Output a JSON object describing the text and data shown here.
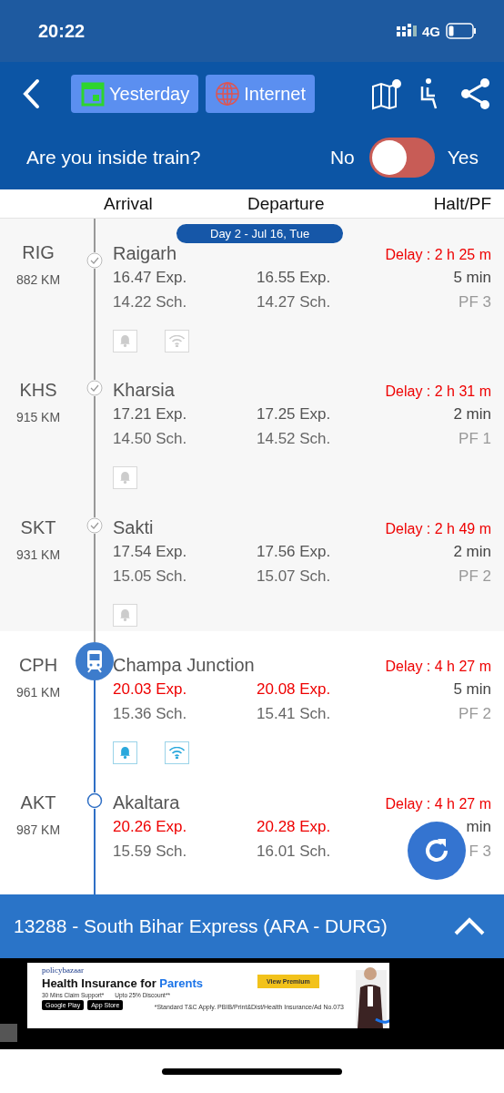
{
  "status_bar": {
    "time": "20:22",
    "network": "4G"
  },
  "toolbar": {
    "buttons": [
      {
        "kind": "calendar",
        "label": "Yesterday"
      },
      {
        "kind": "globe",
        "label": "Internet"
      }
    ]
  },
  "inside_train": {
    "question": "Are you inside train?",
    "no_label": "No",
    "yes_label": "Yes",
    "on": false
  },
  "columns": [
    "Arrival",
    "Departure",
    "Halt/PF"
  ],
  "stations": [
    {
      "code": "RIG",
      "km": "882 KM",
      "name": "Raigarh",
      "day_label": "Day 2 - Jul 16, Tue",
      "delay": "Delay : 2 h  25 m",
      "arr_exp": "16.47 Exp.",
      "dep_exp": "16.55 Exp.",
      "halt": "5 min",
      "arr_sch": "14.22 Sch.",
      "dep_sch": "14.27 Sch.",
      "pf": "PF 3",
      "passed": true,
      "current": false,
      "late": false,
      "amenities": [
        {
          "kind": "alarm",
          "active": false
        },
        {
          "kind": "wifi",
          "active": false
        }
      ]
    },
    {
      "code": "KHS",
      "km": "915 KM",
      "name": "Kharsia",
      "delay": "Delay : 2 h  31 m",
      "arr_exp": "17.21 Exp.",
      "dep_exp": "17.25 Exp.",
      "halt": "2 min",
      "arr_sch": "14.50 Sch.",
      "dep_sch": "14.52 Sch.",
      "pf": "PF 1",
      "passed": true,
      "current": false,
      "late": false,
      "amenities": [
        {
          "kind": "alarm",
          "active": false
        }
      ]
    },
    {
      "code": "SKT",
      "km": "931 KM",
      "name": "Sakti",
      "delay": "Delay : 2 h  49 m",
      "arr_exp": "17.54 Exp.",
      "dep_exp": "17.56 Exp.",
      "halt": "2 min",
      "arr_sch": "15.05 Sch.",
      "dep_sch": "15.07 Sch.",
      "pf": "PF 2",
      "passed": true,
      "current": false,
      "late": false,
      "amenities": [
        {
          "kind": "alarm",
          "active": false
        }
      ]
    },
    {
      "code": "CPH",
      "km": "961 KM",
      "name": "Champa Junction",
      "delay": "Delay : 4 h  27 m",
      "arr_exp": "20.03 Exp.",
      "dep_exp": "20.08 Exp.",
      "halt": "5 min",
      "arr_sch": "15.36 Sch.",
      "dep_sch": "15.41 Sch.",
      "pf": "PF 2",
      "passed": false,
      "current": true,
      "late": true,
      "amenities": [
        {
          "kind": "alarm",
          "active": true
        },
        {
          "kind": "wifi",
          "active": true
        }
      ]
    },
    {
      "code": "AKT",
      "km": "987 KM",
      "name": "Akaltara",
      "delay": "Delay : 4 h  27 m",
      "arr_exp": "20.26 Exp.",
      "dep_exp": "20.28 Exp.",
      "halt": "min",
      "arr_sch": "15.59 Sch.",
      "dep_sch": "16.01 Sch.",
      "pf": "F 3",
      "passed": false,
      "current": false,
      "late": true
    }
  ],
  "train_bar": {
    "title": "13288 - South Bihar Express (ARA - DURG)"
  },
  "ad": {
    "logo": "policybazaar",
    "headline": "Health Insurance for",
    "headline_highlight": "Parents",
    "points": [
      "30 Mins Claim Support*",
      "Upto 25% Discount**"
    ],
    "stores": [
      "Google Play",
      "App Store"
    ],
    "button": "View Premium",
    "disclaimer": "*Standard T&C Apply. PBIB/Print&Dist/Health Insurance/Ad No.073"
  }
}
